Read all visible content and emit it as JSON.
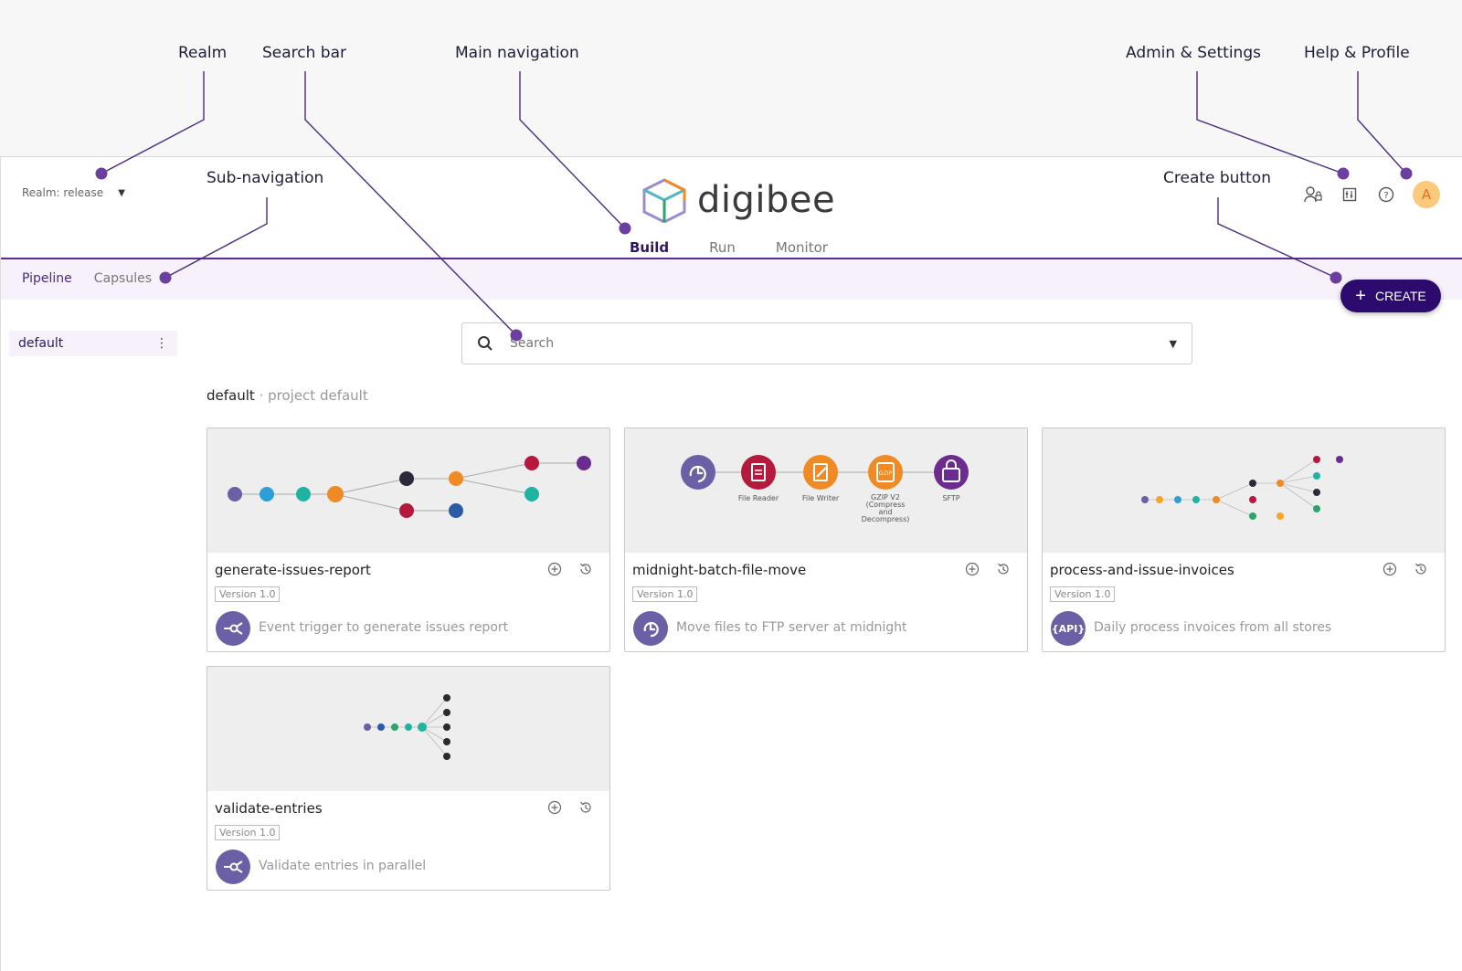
{
  "annotations": {
    "realm": "Realm",
    "search_bar": "Search bar",
    "main_navigation": "Main navigation",
    "admin_settings": "Admin & Settings",
    "help_profile": "Help & Profile",
    "sub_navigation": "Sub-navigation",
    "create_button": "Create button"
  },
  "header": {
    "realm_label": "Realm: release",
    "logo_text": "digibee",
    "tabs": [
      "Build",
      "Run",
      "Monitor"
    ],
    "active_tab": "Build",
    "avatar_initial": "A"
  },
  "subnav": {
    "items": [
      "Pipeline",
      "Capsules"
    ],
    "active": "Pipeline"
  },
  "create_label": "CREATE",
  "sidebar": {
    "project": "default"
  },
  "search": {
    "placeholder": "Search"
  },
  "breadcrumb": {
    "project": "default",
    "separator": "·",
    "subtitle": "project default"
  },
  "cards": [
    {
      "name": "generate-issues-report",
      "version": "Version 1.0",
      "trigger": "event",
      "description": "Event trigger to generate issues report"
    },
    {
      "name": "midnight-batch-file-move",
      "version": "Version 1.0",
      "trigger": "scheduler",
      "description": "Move files to FTP server at midnight",
      "preview_labels": [
        "File Reader",
        "File Writer",
        "GZIP V2\n(Compress\nand\nDecompress)",
        "SFTP"
      ]
    },
    {
      "name": "process-and-issue-invoices",
      "version": "Version 1.0",
      "trigger": "api",
      "trigger_label": "{API}",
      "description": "Daily process invoices from all stores"
    },
    {
      "name": "validate-entries",
      "version": "Version 1.0",
      "trigger": "event",
      "description": "Validate entries in parallel"
    }
  ],
  "colors": {
    "accent": "#5a2d91",
    "create_bg": "#2d0a6e",
    "subbar_bg": "#f6f1fb",
    "avatar_bg": "#fbc97b"
  }
}
